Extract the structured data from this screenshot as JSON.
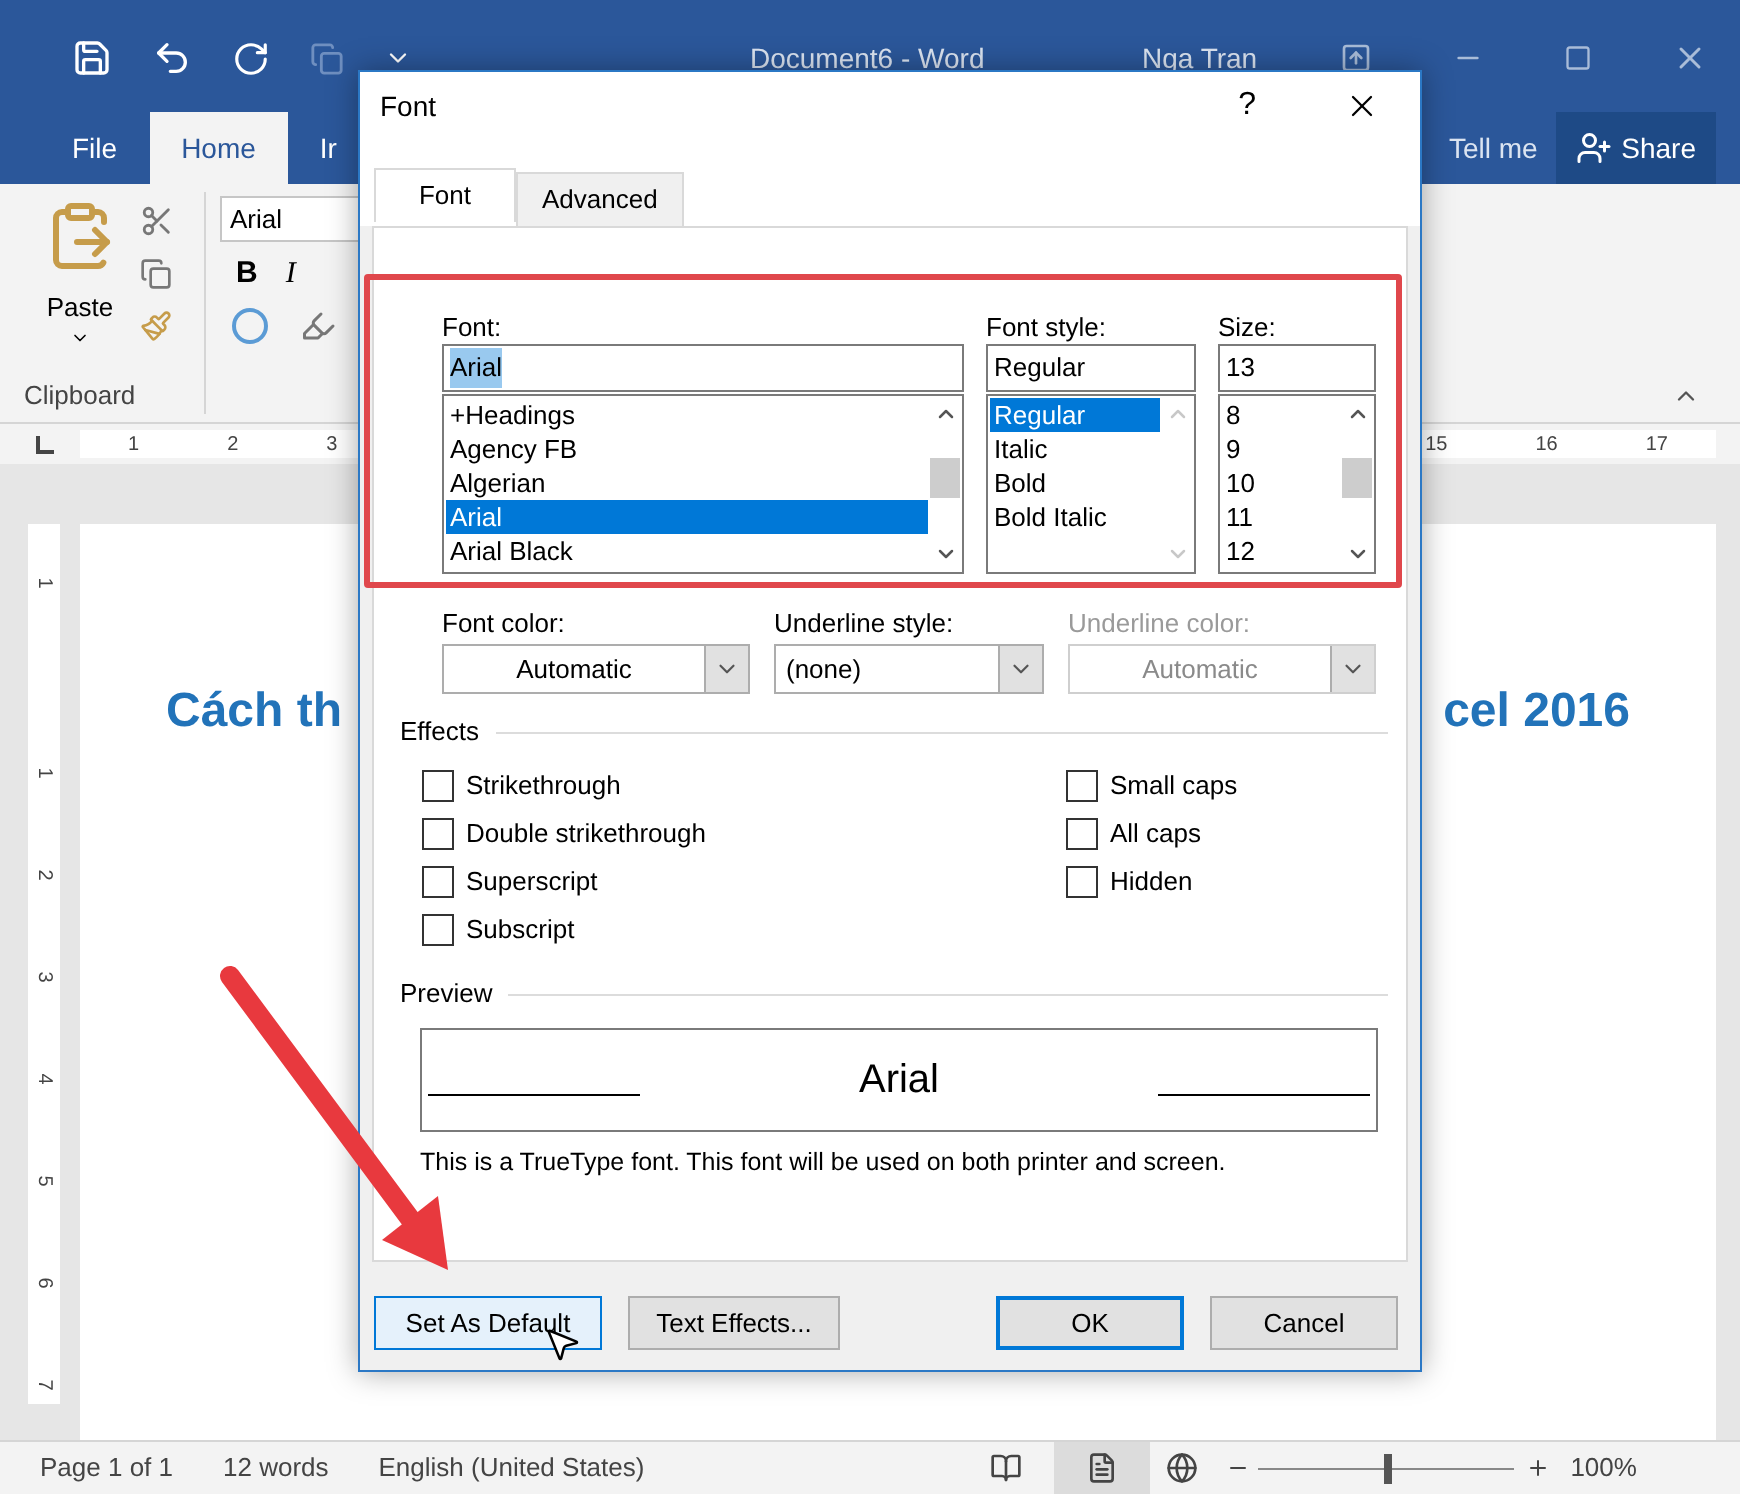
{
  "word": {
    "title": "Document6 - Word",
    "user": "Nga Tran",
    "ribbon_tabs": [
      {
        "label": "File",
        "selected": false
      },
      {
        "label": "Home",
        "selected": true
      },
      {
        "label": "Ir",
        "selected": false
      }
    ],
    "tell_me": "Tell me",
    "share_button": "Share",
    "ribbon": {
      "paste_label": "Paste",
      "group_label": "Clipboard",
      "font_name": "Arial",
      "bold": "B",
      "italic": "I"
    },
    "ruler": {
      "left_numbers": [
        "1",
        "2",
        "3"
      ],
      "right_numbers": [
        "15",
        "16",
        "17"
      ],
      "vertical_numbers": [
        "1",
        "1",
        "2",
        "3",
        "4",
        "5",
        "6",
        "7"
      ]
    },
    "document": {
      "heading_left": "Cách th",
      "heading_right": "cel 2016"
    },
    "status_bar": {
      "page": "Page 1 of 1",
      "words": "12 words",
      "language": "English (United States)",
      "zoom": {
        "level": 0.49,
        "reading": "100%"
      }
    }
  },
  "dialog": {
    "title": "Font",
    "help": "?",
    "tabs": [
      {
        "label": "Font",
        "selected": true
      },
      {
        "label": "Advanced",
        "selected": false
      }
    ],
    "font": {
      "label": "Font:",
      "value": "Arial",
      "items": [
        {
          "label": "+Headings",
          "selected": false
        },
        {
          "label": "Agency FB",
          "selected": false
        },
        {
          "label": "Algerian",
          "selected": false
        },
        {
          "label": "Arial",
          "selected": true
        },
        {
          "label": "Arial Black",
          "selected": false
        }
      ]
    },
    "font_style": {
      "label": "Font style:",
      "value": "Regular",
      "items": [
        {
          "label": "Regular",
          "selected": true
        },
        {
          "label": "Italic",
          "selected": false
        },
        {
          "label": "Bold",
          "selected": false
        },
        {
          "label": "Bold Italic",
          "selected": false
        }
      ]
    },
    "size": {
      "label": "Size:",
      "value": "13",
      "items": [
        {
          "label": "8",
          "selected": false
        },
        {
          "label": "9",
          "selected": false
        },
        {
          "label": "10",
          "selected": false
        },
        {
          "label": "11",
          "selected": false
        },
        {
          "label": "12",
          "selected": false
        }
      ]
    },
    "dropdowns": [
      {
        "label": "Font color:",
        "value": "Automatic",
        "disabled": false
      },
      {
        "label": "Underline style:",
        "value": "(none)",
        "disabled": false
      },
      {
        "label": "Underline color:",
        "value": "Automatic",
        "disabled": true
      }
    ],
    "effects": {
      "title": "Effects",
      "left": [
        {
          "label": "Strikethrough",
          "checked": false
        },
        {
          "label": "Double strikethrough",
          "checked": false
        },
        {
          "label": "Superscript",
          "checked": false
        },
        {
          "label": "Subscript",
          "checked": false
        }
      ],
      "right": [
        {
          "label": "Small caps",
          "checked": false
        },
        {
          "label": "All caps",
          "checked": false
        },
        {
          "label": "Hidden",
          "checked": false
        }
      ]
    },
    "preview": {
      "title": "Preview",
      "sample": "Arial",
      "note": "This is a TrueType font. This font will be used on both printer and screen."
    },
    "buttons": [
      {
        "label": "Set As Default",
        "hovered": true,
        "default": false
      },
      {
        "label": "Text Effects...",
        "hovered": false,
        "default": false
      },
      {
        "label": "OK",
        "hovered": false,
        "default": true
      },
      {
        "label": "Cancel",
        "hovered": false,
        "default": false
      }
    ]
  }
}
